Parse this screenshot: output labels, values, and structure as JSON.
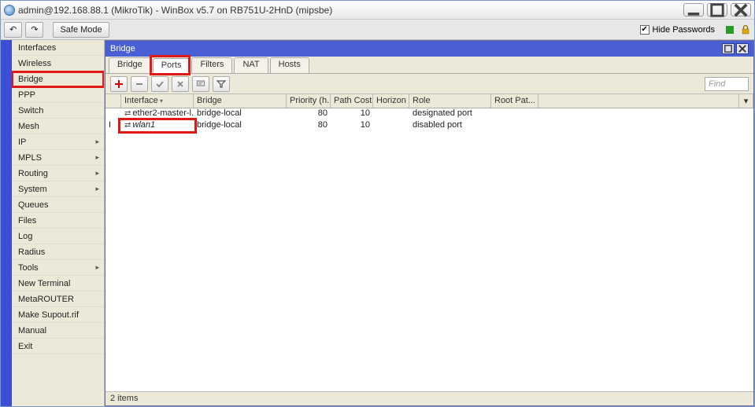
{
  "window": {
    "title": "admin@192.168.88.1 (MikroTik) - WinBox v5.7 on RB751U-2HnD (mipsbe)"
  },
  "toolbar": {
    "undo": "↶",
    "redo": "↷",
    "safe_mode": "Safe Mode",
    "hide_passwords": "Hide Passwords"
  },
  "sidebar": {
    "items": [
      {
        "label": "Interfaces",
        "submenu": false
      },
      {
        "label": "Wireless",
        "submenu": false
      },
      {
        "label": "Bridge",
        "submenu": false,
        "highlighted": true
      },
      {
        "label": "PPP",
        "submenu": false
      },
      {
        "label": "Switch",
        "submenu": false
      },
      {
        "label": "Mesh",
        "submenu": false
      },
      {
        "label": "IP",
        "submenu": true
      },
      {
        "label": "MPLS",
        "submenu": true
      },
      {
        "label": "Routing",
        "submenu": true
      },
      {
        "label": "System",
        "submenu": true
      },
      {
        "label": "Queues",
        "submenu": false
      },
      {
        "label": "Files",
        "submenu": false
      },
      {
        "label": "Log",
        "submenu": false
      },
      {
        "label": "Radius",
        "submenu": false
      },
      {
        "label": "Tools",
        "submenu": true
      },
      {
        "label": "New Terminal",
        "submenu": false
      },
      {
        "label": "MetaROUTER",
        "submenu": false
      },
      {
        "label": "Make Supout.rif",
        "submenu": false
      },
      {
        "label": "Manual",
        "submenu": false
      },
      {
        "label": "Exit",
        "submenu": false
      }
    ]
  },
  "inner": {
    "title": "Bridge",
    "tabs": [
      "Bridge",
      "Ports",
      "Filters",
      "NAT",
      "Hosts"
    ],
    "active_tab": "Ports",
    "find_placeholder": "Find",
    "columns": [
      "",
      "Interface",
      "Bridge",
      "Priority (h...",
      "Path Cost",
      "Horizon",
      "Role",
      "Root Pat..."
    ],
    "rows": [
      {
        "flag": "",
        "interface": "ether2-master-l...",
        "bridge": "bridge-local",
        "priority": "80",
        "pathcost": "10",
        "horizon": "",
        "role": "designated port",
        "rootpath": ""
      },
      {
        "flag": "I",
        "interface": "wlan1",
        "bridge": "bridge-local",
        "priority": "80",
        "pathcost": "10",
        "horizon": "",
        "role": "disabled port",
        "rootpath": ""
      }
    ],
    "status": "2 items"
  }
}
